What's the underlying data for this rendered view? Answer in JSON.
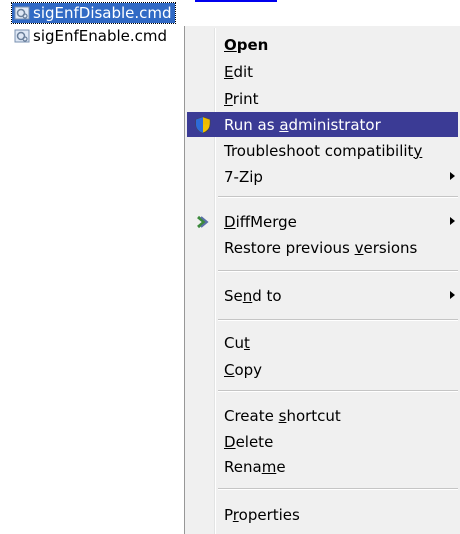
{
  "files": [
    {
      "name": "sigEnfDisable.cmd",
      "selected": true,
      "icon": "cmd-file-icon"
    },
    {
      "name": "sigEnfEnable.cmd",
      "selected": false,
      "icon": "cmd-file-icon"
    }
  ],
  "menu": {
    "items": [
      {
        "key": "open",
        "label": "Open",
        "mnemonic": "O",
        "bold": true
      },
      {
        "key": "edit",
        "label": "Edit",
        "mnemonic": "E"
      },
      {
        "key": "print",
        "label": "Print",
        "mnemonic": "P"
      },
      {
        "key": "run-as-admin",
        "label": "Run as administrator",
        "mnemonic": "a",
        "icon": "uac-shield-icon",
        "highlighted": true
      },
      {
        "key": "troubleshoot",
        "label": "Troubleshoot compatibility",
        "mnemonic": "y"
      },
      {
        "key": "7zip",
        "label": "7-Zip",
        "submenu": true
      },
      {
        "key": "diffmerge",
        "label": "DiffMerge",
        "mnemonic": "D",
        "icon": "diffmerge-icon",
        "submenu": true
      },
      {
        "key": "restore",
        "label": "Restore previous versions",
        "mnemonic": "v"
      },
      {
        "key": "send-to",
        "label": "Send to",
        "mnemonic": "n",
        "submenu": true
      },
      {
        "key": "cut",
        "label": "Cut",
        "mnemonic": "t"
      },
      {
        "key": "copy",
        "label": "Copy",
        "mnemonic": "C"
      },
      {
        "key": "create-shortcut",
        "label": "Create shortcut",
        "mnemonic": "s"
      },
      {
        "key": "delete",
        "label": "Delete",
        "mnemonic": "D"
      },
      {
        "key": "rename",
        "label": "Rename",
        "mnemonic": "m"
      },
      {
        "key": "properties",
        "label": "Properties",
        "mnemonic": "r"
      }
    ]
  },
  "colors": {
    "selection": "#316ac5",
    "menu_highlight": "#3b3b95",
    "menu_background": "#f0f0f0"
  }
}
